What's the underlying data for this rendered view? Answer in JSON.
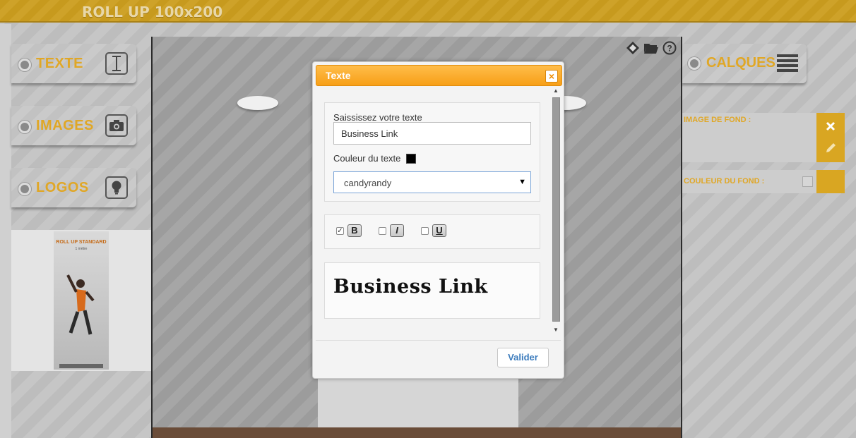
{
  "app": {
    "title": "ROLL UP 100x200"
  },
  "left_tools": [
    {
      "label": "TEXTE",
      "icon": "text-cursor-icon"
    },
    {
      "label": "IMAGES",
      "icon": "camera-icon"
    },
    {
      "label": "LOGOS",
      "icon": "lightbulb-icon"
    }
  ],
  "thumbnail": {
    "title": "ROLL UP STANDARD",
    "subtitle": "1 mètre"
  },
  "canvas_toolbar": {
    "icons": [
      "layers-edit-icon",
      "folder-icon",
      "help-icon"
    ]
  },
  "right_panel": {
    "calques_label": "CALQUES",
    "image_fond_label": "IMAGE DE FOND :",
    "couleur_fond_label": "COULEUR DU FOND :"
  },
  "dialog": {
    "title": "Texte",
    "close_symbol": "×",
    "text_prompt": "Saississez votre texte",
    "text_value": "Business Link",
    "color_label": "Couleur du texte",
    "text_color": "#000000",
    "font_selected": "candyrandy",
    "bold_label": "B",
    "italic_label": "I",
    "underline_label": "U",
    "bold_checked": true,
    "italic_checked": false,
    "underline_checked": false,
    "preview_text": "Business Link",
    "validate_label": "Valider"
  },
  "colors": {
    "accent": "#e0a726",
    "header": "#f79f17",
    "link": "#3c7cbd"
  }
}
